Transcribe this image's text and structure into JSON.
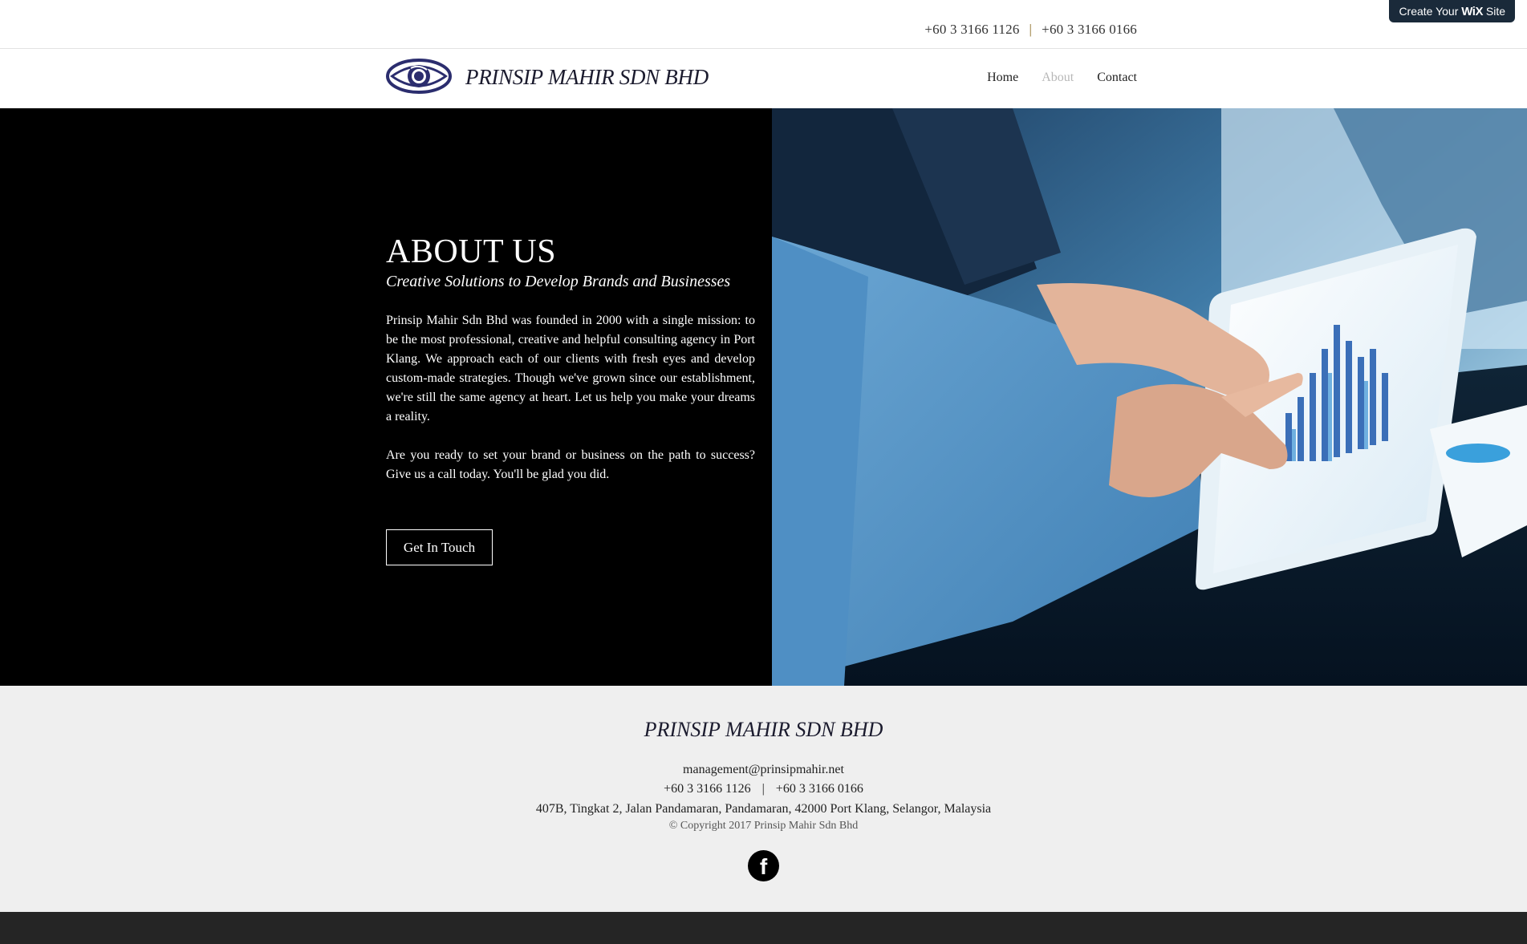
{
  "topbar": {
    "phone1": "+60 3 3166 1126",
    "separator": "|",
    "phone2": "+60 3 3166 0166"
  },
  "wix_badge": {
    "prefix": "Create Your",
    "brand": "WiX",
    "suffix": "Site"
  },
  "header": {
    "brand": "PRINSIP MAHIR SDN BHD",
    "logo_icon": "eye-icon",
    "nav": [
      {
        "label": "Home",
        "active": false
      },
      {
        "label": "About",
        "active": true
      },
      {
        "label": "Contact",
        "active": false
      }
    ]
  },
  "hero": {
    "title": "ABOUT US",
    "subtitle": "Creative Solutions to Develop Brands and Businesses",
    "paragraph1": "Prinsip Mahir Sdn Bhd was founded in 2000 with a single mission: to be the most professional, creative and helpful consulting agency in Port Klang. We approach each of our clients with fresh eyes and develop custom-made strategies. Though we've grown since our establishment, we're still the same agency at heart. Let us help you make your dreams a reality.",
    "paragraph2": "Are you ready to set your brand or business on the path to success? Give us a call today. You'll be glad you did.",
    "cta_label": "Get In Touch"
  },
  "footer": {
    "brand": "PRINSIP MAHIR SDN BHD",
    "email": "management@prinsipmahir.net",
    "phone1": "+60 3 3166 1126",
    "separator": "|",
    "phone2": "+60 3 3166 0166",
    "address": "407B, Tingkat 2, Jalan Pandamaran, Pandamaran, 42000 Port Klang, Selangor, Malaysia",
    "copyright": "© Copyright 2017 Prinsip Mahir Sdn Bhd",
    "social_icon": "facebook-icon"
  },
  "colors": {
    "hero_bg": "#000000",
    "footer_bg": "#efefef",
    "logo": "#2b2d6e",
    "nav_active": "#b7b7b7",
    "bottom_bar": "#252525"
  }
}
